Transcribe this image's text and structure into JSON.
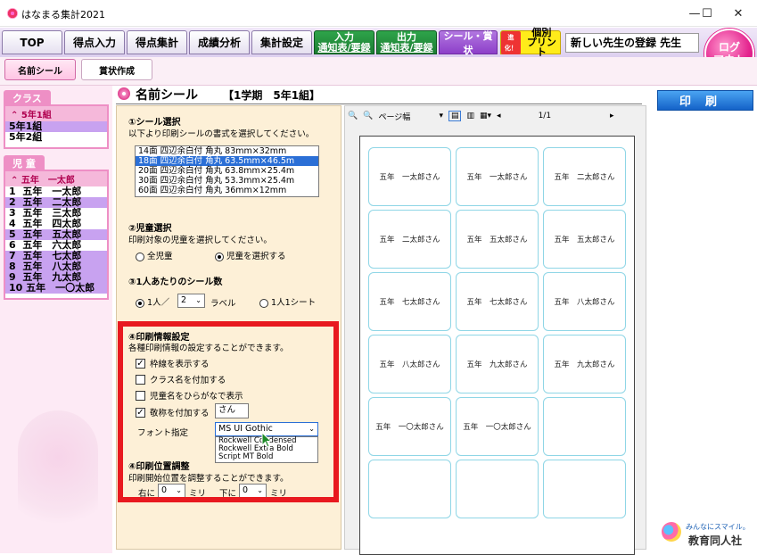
{
  "window": {
    "title": "はなまる集計2021",
    "minimize": "—",
    "maximize": "☐",
    "close": "✕"
  },
  "nav": {
    "tabs": [
      {
        "label": "TOP"
      },
      {
        "label": "得点入力"
      },
      {
        "label": "得点集計"
      },
      {
        "label": "成績分析"
      },
      {
        "label": "集計設定"
      },
      {
        "label1": "入力",
        "label2": "通知表/要録"
      },
      {
        "label1": "出力",
        "label2": "通知表/要録"
      },
      {
        "label": "シール・賞状"
      },
      {
        "badge": "進化！",
        "label1": "個別",
        "label2": "プリント"
      }
    ],
    "teacher": "新しい先生の登録 先生",
    "logout_line1": "ログ",
    "logout_line2": "アウト"
  },
  "subnav": {
    "items": [
      {
        "label": "名前シール"
      },
      {
        "label": "賞状作成"
      }
    ]
  },
  "sidebar": {
    "class_title": "クラス",
    "class_header": "5年1組",
    "classes": [
      "5年1組",
      "5年2組"
    ],
    "student_title": "児 童",
    "student_header": "五年　一太郎",
    "students": [
      "1  五年　一太郎",
      "2  五年　二太郎",
      "3  五年　三太郎",
      "4  五年　四太郎",
      "5  五年　五太郎",
      "6  五年　六太郎",
      "7  五年　七太郎",
      "8  五年　八太郎",
      "9  五年　九太郎",
      "10 五年　一〇太郎"
    ]
  },
  "page": {
    "title": "名前シール",
    "subtitle": "【1学期　5年1組】"
  },
  "form": {
    "s1_title": "①シール選択",
    "s1_desc": "以下より印刷シールの書式を選択してください。",
    "formats": [
      "14面 四辺余白付 角丸 83mm×32mm",
      "18面 四辺余白付 角丸 63.5mm×46.5m",
      "20面 四辺余白付 角丸 63.8mm×25.4m",
      "30面 四辺余白付 角丸 53.3mm×25.4m",
      "60面 四辺余白付 角丸 36mm×12mm"
    ],
    "s2_title": "②児童選択",
    "s2_desc": "印刷対象の児童を選択してください。",
    "opt_all": "全児童",
    "opt_select": "児童を選択する",
    "s3_title": "③1人あたりのシール数",
    "per_person_prefix": "1人／",
    "per_person_value": "2",
    "per_person_unit": "ラベル",
    "one_sheet": "1人1シート",
    "s4_title": "④印刷情報設定",
    "s4_desc": "各種印刷情報の設定することができます。",
    "chk_border": "枠線を表示する",
    "chk_class": "クラス名を付加する",
    "chk_hiragana": "児童名をひらがなで表示",
    "chk_honorific": "敬称を付加する",
    "honorific_value": "さん",
    "font_label": "フォント指定",
    "font_value": "MS UI Gothic",
    "font_options": [
      "Rockwell Condensed",
      "Rockwell Extra Bold",
      "Script MT Bold"
    ],
    "s5_title": "④印刷位置調整",
    "s5_desc": "印刷開始位置を調整することができます。",
    "right_label": "右に",
    "right_value": "0",
    "down_label": "下に",
    "down_value": "0",
    "unit": "ミリ"
  },
  "preview": {
    "zoom": "ページ幅",
    "page": "1/1",
    "labels": [
      "五年　一太郎さん",
      "五年　一太郎さん",
      "五年　二太郎さん",
      "五年　二太郎さん",
      "五年　五太郎さん",
      "五年　五太郎さん",
      "五年　七太郎さん",
      "五年　七太郎さん",
      "五年　八太郎さん",
      "五年　八太郎さん",
      "五年　九太郎さん",
      "五年　九太郎さん",
      "五年　一〇太郎さん",
      "五年　一〇太郎さん",
      "",
      "",
      "",
      ""
    ]
  },
  "print_button": "印刷",
  "logo": {
    "tagline": "みんなにスマイル。",
    "company": "教育同人社"
  }
}
